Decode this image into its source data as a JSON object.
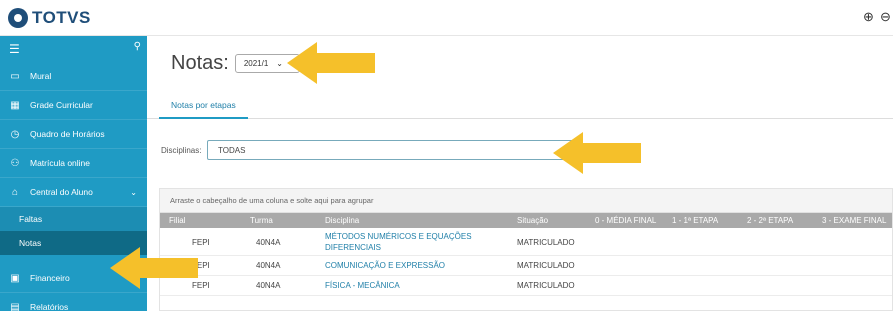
{
  "header": {
    "logo_text": "TOTVS",
    "zoom_in_icon": "zoom-in-icon",
    "zoom_out_icon": "zoom-out-icon"
  },
  "sidebar": {
    "items": [
      {
        "label": "Mural",
        "icon": "monitor-icon"
      },
      {
        "label": "Grade Curricular",
        "icon": "grid-icon"
      },
      {
        "label": "Quadro de Horários",
        "icon": "clock-icon"
      },
      {
        "label": "Matrícula online",
        "icon": "add-user-icon"
      },
      {
        "label": "Central do Aluno",
        "icon": "graduation-cap-icon"
      },
      {
        "label": "Financeiro",
        "icon": "money-icon"
      },
      {
        "label": "Relatórios",
        "icon": "document-icon"
      }
    ],
    "sub_items": [
      {
        "label": "Faltas"
      },
      {
        "label": "Notas",
        "active": true
      }
    ]
  },
  "main": {
    "title": "Notas:",
    "period_select": {
      "value": "2021/1"
    },
    "tabs": [
      {
        "label": "Notas por etapas",
        "active": true
      }
    ],
    "disciplinas_label": "Disciplinas:",
    "disciplinas_value": "TODAS",
    "group_hint": "Arraste o cabeçalho de uma coluna e solte aqui para agrupar",
    "columns": [
      "Filial",
      "Turma",
      "Disciplina",
      "Situação",
      "0 - MÉDIA FINAL",
      "1 - 1ª ETAPA",
      "2 - 2ª ETAPA",
      "3 - EXAME FINAL"
    ],
    "rows": [
      {
        "filial": "FEPI",
        "turma": "40N4A",
        "disciplina_l1": "MÉTODOS NUMÉRICOS E EQUAÇÕES",
        "disciplina_l2": "DIFERENCIAIS",
        "situacao": "MATRICULADO"
      },
      {
        "filial": "FEPI",
        "turma": "40N4A",
        "disciplina_l1": "COMUNICAÇÃO E EXPRESSÃO",
        "disciplina_l2": "",
        "situacao": "MATRICULADO"
      },
      {
        "filial": "FEPI",
        "turma": "40N4A",
        "disciplina_l1": "FÍSICA - MECÂNICA",
        "disciplina_l2": "",
        "situacao": "MATRICULADO"
      }
    ]
  },
  "colors": {
    "sidebar_bg": "#1f9bc4",
    "active_item_bg": "#0f6a86",
    "arrow": "#f5c02a",
    "header_row": "#a9a9a9"
  }
}
